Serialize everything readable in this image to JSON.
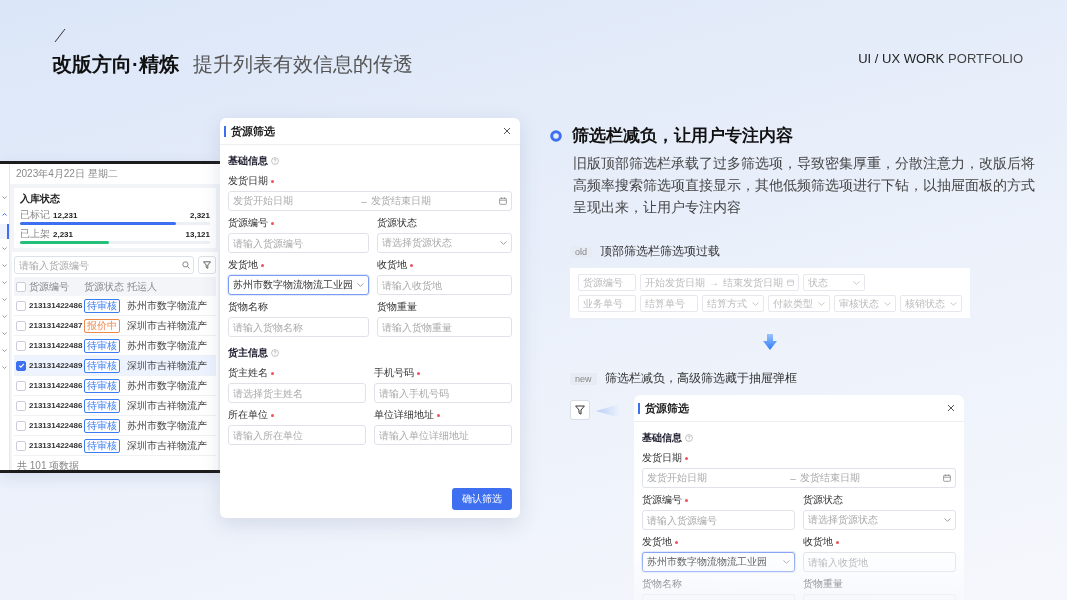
{
  "header": {
    "title": "改版方向·精炼",
    "subtitle": "提升列表有效信息的传透",
    "brand": "UI / UX WORK",
    "brand_suffix": "PORTFOLIO"
  },
  "list_screen": {
    "sidebar": {
      "items": [
        {
          "kind": "group",
          "expanded": false,
          "selected": false
        },
        {
          "kind": "group",
          "expanded": true,
          "selected": false
        },
        {
          "kind": "child",
          "selected": true
        },
        {
          "kind": "group",
          "expanded": false,
          "selected": false
        },
        {
          "kind": "group",
          "expanded": false,
          "selected": false
        },
        {
          "kind": "group",
          "expanded": false,
          "selected": false
        },
        {
          "kind": "group",
          "expanded": false,
          "selected": false
        },
        {
          "kind": "group",
          "expanded": false,
          "selected": false
        },
        {
          "kind": "group",
          "expanded": false,
          "selected": false
        },
        {
          "kind": "group",
          "expanded": false,
          "selected": false
        },
        {
          "kind": "group",
          "expanded": false,
          "selected": false
        }
      ]
    },
    "date": "2023年4月22日 星期二",
    "stock_card": {
      "title": "入库状态",
      "bars": [
        {
          "label": "已标记",
          "count": "12,231",
          "total": "2,321",
          "level": 0.82,
          "color": "#3d6ff0"
        },
        {
          "label": "已上架",
          "count": "2,231",
          "total": "13,121",
          "level": 0.47,
          "color": "#23c07a"
        }
      ]
    },
    "search": {
      "placeholder": "请输入货源编号"
    },
    "all_checked": false,
    "columns": [
      "货源编号",
      "货源状态",
      "托运人"
    ],
    "rows": [
      {
        "id": "213131422486",
        "status": "待审核",
        "color": "#3b7cf5",
        "shipper": "苏州市数字物流产",
        "checked": false
      },
      {
        "id": "213131422487",
        "status": "报价中",
        "color": "#f0874a",
        "shipper": "深圳市吉祥物流产",
        "checked": false
      },
      {
        "id": "213131422488",
        "status": "待审核",
        "color": "#3b7cf5",
        "shipper": "苏州市数字物流产",
        "checked": false
      },
      {
        "id": "213131422489",
        "status": "待审核",
        "color": "#3b7cf5",
        "shipper": "深圳市吉祥物流产",
        "checked": true
      },
      {
        "id": "213131422486",
        "status": "待审核",
        "color": "#3b7cf5",
        "shipper": "苏州市数字物流产",
        "checked": false
      },
      {
        "id": "213131422486",
        "status": "待审核",
        "color": "#3b7cf5",
        "shipper": "深圳市吉祥物流产",
        "checked": false
      },
      {
        "id": "213131422486",
        "status": "待审核",
        "color": "#3b7cf5",
        "shipper": "苏州市数字物流产",
        "checked": false
      },
      {
        "id": "213131422486",
        "status": "待审核",
        "color": "#3b7cf5",
        "shipper": "深圳市吉祥物流产",
        "checked": false
      }
    ],
    "footer": "共 101 项数据"
  },
  "filter_drawer": {
    "title": "货源筛选",
    "sections": [
      {
        "title": "基础信息",
        "fields": [
          {
            "label": "发货日期",
            "required": true,
            "kind": "date_range",
            "start_placeholder": "发货开始日期",
            "separator": "–",
            "end_placeholder": "发货结束日期",
            "focused": false
          },
          {
            "label": "货源编号",
            "required": true,
            "kind": "text",
            "placeholder": "请输入货源编号",
            "focused": false
          },
          {
            "label": "货源状态",
            "required": false,
            "kind": "select",
            "placeholder": "请选择货源状态",
            "focused": false
          },
          {
            "label": "发货地",
            "required": true,
            "kind": "select",
            "value": "苏州市数字物流物流工业园",
            "focused": true
          },
          {
            "label": "收货地",
            "required": true,
            "kind": "text",
            "placeholder": "请输入收货地",
            "focused": false
          },
          {
            "label": "货物名称",
            "required": false,
            "kind": "text",
            "placeholder": "请输入货物名称",
            "focused": false
          },
          {
            "label": "货物重量",
            "required": false,
            "kind": "text",
            "placeholder": "请输入货物重量",
            "focused": false
          }
        ]
      },
      {
        "title": "货主信息",
        "fields": [
          {
            "label": "货主姓名",
            "required": true,
            "kind": "text",
            "placeholder": "请选择货主姓名",
            "focused": false
          },
          {
            "label": "手机号码",
            "required": true,
            "kind": "text",
            "placeholder": "请输入手机号码",
            "focused": false
          },
          {
            "label": "所在单位",
            "required": true,
            "kind": "text",
            "placeholder": "请输入所在单位",
            "focused": false
          },
          {
            "label": "单位详细地址",
            "required": true,
            "kind": "text",
            "placeholder": "请输入单位详细地址",
            "focused": false
          }
        ]
      }
    ],
    "confirm_button": "确认筛选"
  },
  "feature": {
    "title": "筛选栏减负，让用户专注内容",
    "body": "旧版顶部筛选栏承载了过多筛选项，导致密集厚重，分散注意力，改版后将高频率搜索筛选项直接显示，其他低频筛选项进行下钻，以抽屉面板的方式呈现出来，让用户专注内容"
  },
  "old_design": {
    "tag": "old",
    "caption": "顶部筛选栏筛选项过载",
    "filter_rows": [
      {
        "fields": [
          {
            "kind": "text",
            "placeholder": "货源编号"
          },
          {
            "kind": "date_range",
            "start_placeholder": "开始发货日期",
            "separator": "→",
            "end_placeholder": "结束发货日期"
          },
          {
            "kind": "select",
            "placeholder": "状态"
          }
        ]
      },
      {
        "fields": [
          {
            "kind": "text",
            "placeholder": "业务单号"
          },
          {
            "kind": "text",
            "placeholder": "结算单号"
          },
          {
            "kind": "select",
            "placeholder": "结算方式"
          },
          {
            "kind": "select",
            "placeholder": "付款类型"
          },
          {
            "kind": "select",
            "placeholder": "审核状态"
          },
          {
            "kind": "select",
            "placeholder": "核销状态"
          }
        ]
      }
    ]
  },
  "new_design": {
    "tag": "new",
    "caption": "筛选栏减负，高级筛选藏于抽屉弹框",
    "drawer": {
      "title": "货源筛选",
      "sections": [
        {
          "title": "基础信息",
          "fields": [
            {
              "label": "发货日期",
              "required": true,
              "kind": "date_range",
              "start_placeholder": "发货开始日期",
              "separator": "–",
              "end_placeholder": "发货结束日期",
              "focused": false
            },
            {
              "label": "货源编号",
              "required": true,
              "kind": "text",
              "placeholder": "请输入货源编号",
              "focused": false
            },
            {
              "label": "货源状态",
              "required": false,
              "kind": "select",
              "placeholder": "请选择货源状态",
              "focused": false
            },
            {
              "label": "发货地",
              "required": true,
              "kind": "select",
              "value": "苏州市数字物流物流工业园",
              "focused": true
            },
            {
              "label": "收货地",
              "required": true,
              "kind": "text",
              "placeholder": "请输入收货地",
              "focused": false
            },
            {
              "label": "货物名称",
              "required": false,
              "kind": "text",
              "focused": false
            },
            {
              "label": "货物重量",
              "required": false,
              "kind": "text",
              "focused": false
            }
          ]
        }
      ]
    }
  }
}
